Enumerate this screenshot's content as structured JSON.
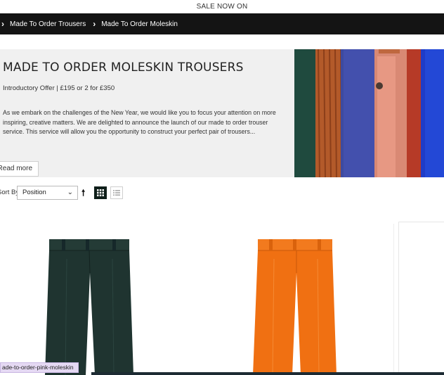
{
  "promo": {
    "text": "SALE NOW ON"
  },
  "breadcrumb": {
    "items": [
      {
        "label": "Made To Order Trousers"
      },
      {
        "label": "Made To Order Moleskin"
      }
    ]
  },
  "hero": {
    "title": "MADE TO ORDER MOLESKIN TROUSERS",
    "offer": "Introductory Offer | £195 or 2 for £350",
    "description": "As we embark on the challenges of the New Year, we would like you to focus your attention on more inspiring, creative matters. We are delighted to announce the launch of our made to order trouser service. This service will allow you the opportunity to construct your perfect pair of trousers...",
    "read_more": "Read more",
    "image_icon": "fabric-swatches-image"
  },
  "toolbar": {
    "sort_label": "Sort By",
    "sort_value": "Position",
    "sort_direction_icon": "arrow-up-icon",
    "view_grid_icon": "grid-view-icon",
    "view_list_icon": "list-view-icon"
  },
  "products": [
    {
      "color": "#1f3430",
      "image_icon": "dark-green-trousers-image"
    },
    {
      "color": "#f07012",
      "image_icon": "orange-trousers-image"
    }
  ],
  "status_bar": {
    "url": "ade-to-order-pink-moleskin"
  }
}
